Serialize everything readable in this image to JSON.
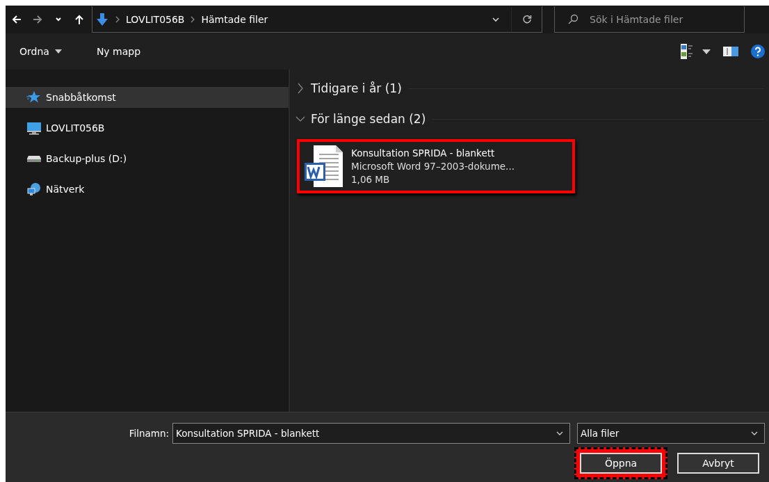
{
  "address_bar": {
    "path": [
      "LOVLIT056B",
      "Hämtade filer"
    ]
  },
  "search": {
    "placeholder": "Sök i Hämtade filer"
  },
  "toolbar": {
    "buttons": [
      "Ordna",
      "Ny mapp"
    ]
  },
  "sidebar": {
    "items": [
      {
        "label": "Snabbåtkomst",
        "kind": "star",
        "selected": true
      },
      {
        "label": "LOVLIT056B",
        "kind": "computer",
        "selected": false
      },
      {
        "label": "Backup-plus (D:)",
        "kind": "drive",
        "selected": false
      },
      {
        "label": "Nätverk",
        "kind": "network",
        "selected": false
      }
    ]
  },
  "groups": [
    {
      "title": "Tidigare i år (1)",
      "expanded": false
    },
    {
      "title": "För länge sedan (2)",
      "expanded": true,
      "files": [
        {
          "name": "Konsultation SPRIDA - blankett",
          "type": "Microsoft Word 97–2003-dokume...",
          "size": "1,06 MB",
          "highlighted": true
        }
      ]
    }
  ],
  "footer": {
    "filename_label": "Filnamn:",
    "filename": "Konsultation SPRIDA - blankett",
    "filter": "Alla filer",
    "buttons": [
      {
        "label": "Öppna",
        "highlighted": true
      },
      {
        "label": "Avbryt",
        "highlighted": false
      }
    ]
  }
}
